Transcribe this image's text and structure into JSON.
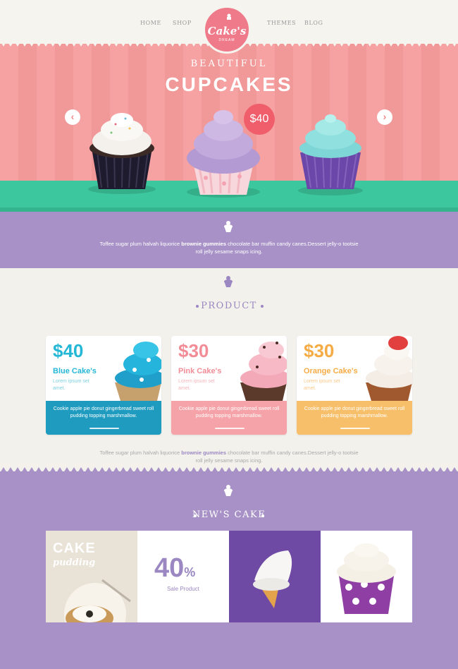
{
  "nav": {
    "left": [
      "HOME",
      "SHOP"
    ],
    "right": [
      "THEMES",
      "BLOG"
    ]
  },
  "logo": {
    "title": "Cake's",
    "subtitle": "DREAM"
  },
  "hero": {
    "line1": "BEAUTIFUL",
    "line2": "CUPCAKES",
    "price": "$40",
    "prev": "‹",
    "next": "›"
  },
  "intro": {
    "text_a": "Toffee sugar plum halvah liquorice ",
    "text_bold": "brownie gummies",
    "text_b": " chocolate bar muffin candy canes.Dessert jelly-o tootsie roll jelly sesame snaps icing."
  },
  "product": {
    "title": "PRODUCT",
    "cards": [
      {
        "price": "$40",
        "name": "Blue Cake's",
        "small": "Lorem ipsum set amet.",
        "desc": "Cookie apple pie donut gingerbread sweet roll pudding topping marshmallow.",
        "accent": "#25b7d6",
        "band": "#1e9bbf"
      },
      {
        "price": "$30",
        "name": "Pink Cake's",
        "small": "Lorem ipsum set amet.",
        "desc": "Cookie apple pie donut gingerbread sweet roll pudding topping marshmallow.",
        "accent": "#f28d97",
        "band": "#f5a3a8"
      },
      {
        "price": "$30",
        "name": "Orange Cake's",
        "small": "Lorem ipsum set amet.",
        "desc": "Cookie apple pie donut gingerbread sweet roll pudding topping marshmallow.",
        "accent": "#f6ac45",
        "band": "#f8bf6a"
      }
    ],
    "outro_a": "Toffee sugar plum halvah liquorice ",
    "outro_bold": "brownie gummies",
    "outro_b": " chocolate bar muffin candy canes.Dessert jelly-o tootsie roll jelly sesame snaps icing."
  },
  "news": {
    "title": "NEW'S CAKE",
    "tile1_line1": "CAKE",
    "tile1_line2": "pudding",
    "sale_value": "40",
    "sale_unit": "%",
    "sale_label": "Sale Product"
  },
  "colors": {
    "pink": "#f19898",
    "green": "#3dc79e",
    "purple": "#a791c6",
    "cream": "#f3f1ec"
  }
}
